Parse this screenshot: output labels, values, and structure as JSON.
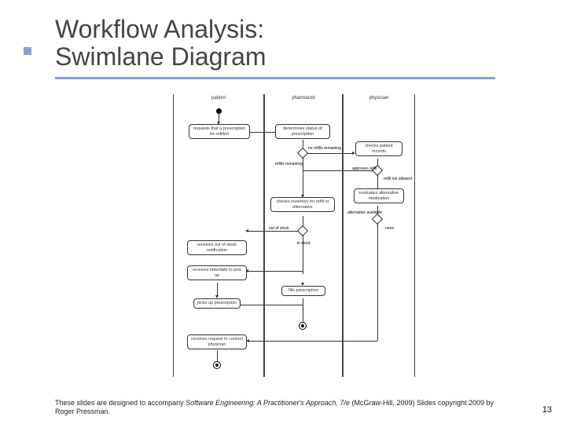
{
  "title_line1": "Workflow Analysis:",
  "title_line2": "Swimlane Diagram",
  "page_number": "13",
  "footer": {
    "prefix": "These slides are designed to accompany ",
    "book": "Software Engineering: A Practitioner's Approach, 7/e",
    "suffix": " (McGraw-Hill, 2009) Slides copyright 2009 by Roger Pressman."
  },
  "swimlane": {
    "lanes": [
      "patient",
      "pharmacist",
      "physician"
    ],
    "nodes": {
      "start": "",
      "p_request": "requests that a prescription be refilled",
      "ph_determine": "determines status of prescription",
      "py_checkrec": "checks patient records",
      "py_eval": "evaluates alternative medication",
      "ph_checkinv": "checks inventory for refill or alternative",
      "p_oos": "receives out of stock notification",
      "p_time": "receives time/date to pick up",
      "p_pickup": "picks up prescription",
      "ph_fill": "fills prescription",
      "p_noref": "receives request to contact physician"
    },
    "decision_labels": {
      "no_refills": "no refills remaining",
      "refills_remain": "refills remaining",
      "approves": "approves refill",
      "not_allowed": "refill not allowed",
      "alt_avail": "alternative available",
      "none": "none",
      "out_of_stock": "out of stock",
      "in_stock": "in stock"
    }
  }
}
